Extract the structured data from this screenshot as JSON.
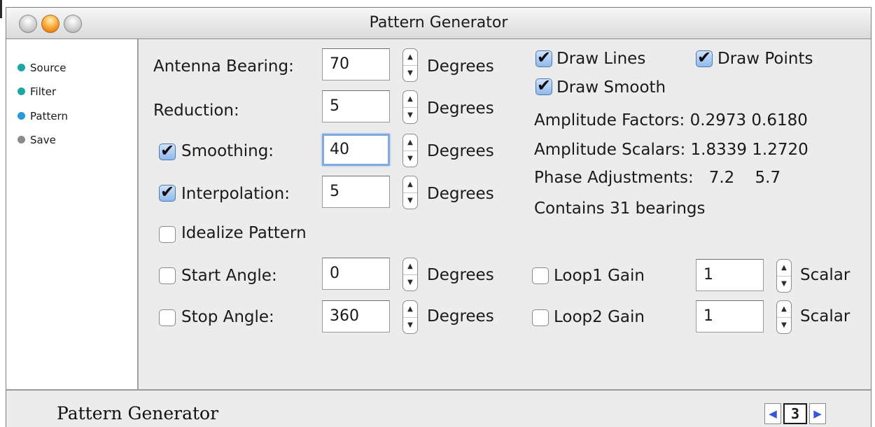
{
  "window": {
    "title": "Pattern Generator"
  },
  "sidebar": {
    "items": [
      {
        "label": "Source",
        "dot_color": "#1aa8a3"
      },
      {
        "label": "Filter",
        "dot_color": "#1aa8a3"
      },
      {
        "label": "Pattern",
        "dot_color": "#2a9ad8",
        "active": true
      },
      {
        "label": "Save",
        "dot_color": "#8b8b8b"
      }
    ]
  },
  "form": {
    "antenna_bearing": {
      "label": "Antenna Bearing:",
      "value": "70",
      "unit": "Degrees"
    },
    "reduction": {
      "label": "Reduction:",
      "value": "5",
      "unit": "Degrees"
    },
    "smoothing": {
      "label": "Smoothing:",
      "value": "40",
      "unit": "Degrees",
      "checked": true
    },
    "interpolation": {
      "label": "Interpolation:",
      "value": "5",
      "unit": "Degrees",
      "checked": true
    },
    "idealize": {
      "label": "Idealize Pattern",
      "checked": false
    },
    "start_angle": {
      "label": "Start Angle:",
      "value": "0",
      "unit": "Degrees",
      "checked": false
    },
    "stop_angle": {
      "label": "Stop Angle:",
      "value": "360",
      "unit": "Degrees",
      "checked": false
    }
  },
  "options": {
    "draw_lines": {
      "label": "Draw Lines",
      "checked": true
    },
    "draw_points": {
      "label": "Draw Points",
      "checked": true
    },
    "draw_smooth": {
      "label": "Draw Smooth",
      "checked": true
    }
  },
  "info": {
    "amplitude_factors": "Amplitude Factors: 0.2973 0.6180",
    "amplitude_scalars": "Amplitude Scalars: 1.8339 1.2720",
    "phase_adjustments": "Phase Adjustments:   7.2    5.7",
    "bearings": "Contains 31 bearings"
  },
  "loops": {
    "loop1": {
      "label": "Loop1 Gain",
      "value": "1",
      "unit": "Scalar",
      "checked": false
    },
    "loop2": {
      "label": "Loop2 Gain",
      "value": "1",
      "unit": "Scalar",
      "checked": false
    }
  },
  "footer": {
    "title": "Pattern Generator",
    "page": "3",
    "prev_glyph": "◀",
    "next_glyph": "▶"
  },
  "glyphs": {
    "check": "✔",
    "step_up": "▲",
    "step_down": "▼"
  }
}
